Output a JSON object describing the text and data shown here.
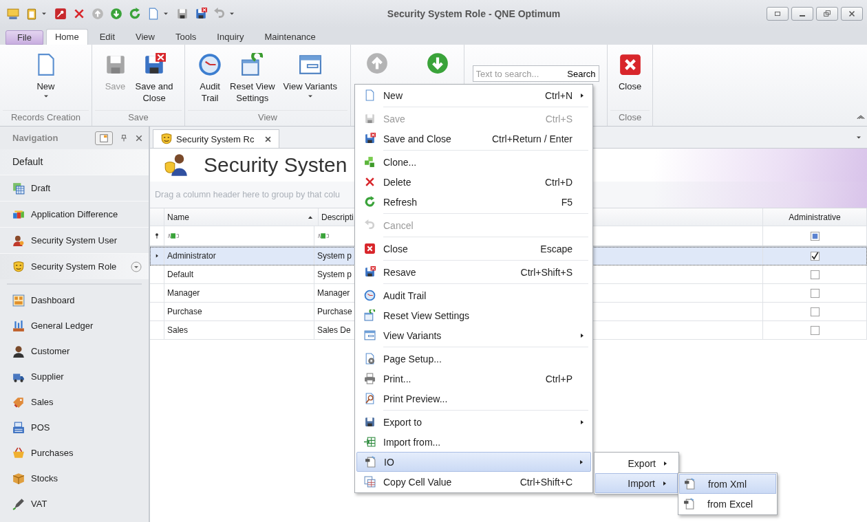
{
  "window": {
    "title": "Security System Role - QNE Optimum"
  },
  "ribbon_tabs": [
    {
      "label": "File",
      "kind": "file",
      "selected": false
    },
    {
      "label": "Home",
      "kind": "tab",
      "selected": true
    },
    {
      "label": "Edit",
      "kind": "tab",
      "selected": false
    },
    {
      "label": "View",
      "kind": "tab",
      "selected": false
    },
    {
      "label": "Tools",
      "kind": "tab",
      "selected": false
    },
    {
      "label": "Inquiry",
      "kind": "tab",
      "selected": false
    },
    {
      "label": "Maintenance",
      "kind": "tab",
      "selected": false
    }
  ],
  "ribbon_groups": [
    {
      "kind": "buttons",
      "label": "Records Creation",
      "buttons": [
        {
          "label": "New",
          "dropdown": true,
          "disabled": false
        }
      ]
    },
    {
      "kind": "buttons",
      "label": "Save",
      "buttons": [
        {
          "label": "Save",
          "dropdown": false,
          "disabled": true
        },
        {
          "label": "Save and\nClose",
          "dropdown": false,
          "disabled": false
        }
      ]
    },
    {
      "kind": "buttons",
      "label": "View",
      "buttons": [
        {
          "label": "Audit\nTrail",
          "dropdown": false,
          "disabled": false
        },
        {
          "label": "Reset View\nSettings",
          "dropdown": false,
          "disabled": false
        },
        {
          "label": "View Variants",
          "dropdown": true,
          "disabled": false
        }
      ]
    },
    {
      "kind": "arrows",
      "buttons": [
        {
          "disabled": true
        },
        {
          "disabled": false
        }
      ]
    },
    {
      "kind": "search",
      "placeholder": "Text to search...",
      "button": "Search"
    },
    {
      "kind": "buttons",
      "label": "Close",
      "buttons": [
        {
          "label": "Close",
          "dropdown": false,
          "disabled": false
        }
      ]
    }
  ],
  "navigation": {
    "title": "Navigation",
    "group_label": "Default",
    "group_items": [
      {
        "label": "Draft",
        "selected": false
      },
      {
        "label": "Application Difference",
        "selected": false
      },
      {
        "label": "Security System User",
        "selected": false
      },
      {
        "label": "Security System Role",
        "selected": true
      }
    ],
    "modules": [
      {
        "label": "Dashboard"
      },
      {
        "label": "General Ledger"
      },
      {
        "label": "Customer"
      },
      {
        "label": "Supplier"
      },
      {
        "label": "Sales"
      },
      {
        "label": "POS"
      },
      {
        "label": "Purchases"
      },
      {
        "label": "Stocks"
      },
      {
        "label": "VAT"
      }
    ]
  },
  "document_tab": {
    "label": "Security System Rc"
  },
  "page_title": "Security Systen",
  "group_hint": "Drag a column header here to group by that colu",
  "grid": {
    "columns": [
      {
        "label": "Name",
        "sorted_ascending": true
      },
      {
        "label": "Descripti"
      },
      {
        "label": "Administrative"
      }
    ],
    "administrative_filter": {
      "indeterminate": true
    },
    "rows": [
      {
        "name": "Administrator",
        "description": "System p",
        "administrative": true,
        "selected": true
      },
      {
        "name": "Default",
        "description": "System p",
        "administrative": false,
        "selected": false
      },
      {
        "name": "Manager",
        "description": "Manager",
        "administrative": false,
        "selected": false
      },
      {
        "name": "Purchase",
        "description": "Purchase",
        "administrative": false,
        "selected": false
      },
      {
        "name": "Sales",
        "description": "Sales De",
        "administrative": false,
        "selected": false
      }
    ]
  },
  "context_menu": {
    "items": [
      {
        "kind": "item",
        "label": "New",
        "shortcut": "Ctrl+N",
        "submenu": true,
        "disabled": false,
        "selected": false
      },
      {
        "kind": "separator"
      },
      {
        "kind": "item",
        "label": "Save",
        "shortcut": "Ctrl+S",
        "submenu": false,
        "disabled": true,
        "selected": false
      },
      {
        "kind": "item",
        "label": "Save and Close",
        "shortcut": "Ctrl+Return / Enter",
        "submenu": false,
        "disabled": false,
        "selected": false
      },
      {
        "kind": "separator"
      },
      {
        "kind": "item",
        "label": "Clone...",
        "submenu": false,
        "disabled": false,
        "selected": false
      },
      {
        "kind": "item",
        "label": "Delete",
        "shortcut": "Ctrl+D",
        "submenu": false,
        "disabled": false,
        "selected": false
      },
      {
        "kind": "item",
        "label": "Refresh",
        "shortcut": "F5",
        "submenu": false,
        "disabled": false,
        "selected": false
      },
      {
        "kind": "separator"
      },
      {
        "kind": "item",
        "label": "Cancel",
        "submenu": false,
        "disabled": true,
        "selected": false
      },
      {
        "kind": "separator"
      },
      {
        "kind": "item",
        "label": "Close",
        "shortcut": "Escape",
        "submenu": false,
        "disabled": false,
        "selected": false
      },
      {
        "kind": "separator"
      },
      {
        "kind": "item",
        "label": "Resave",
        "shortcut": "Ctrl+Shift+S",
        "submenu": false,
        "disabled": false,
        "selected": false
      },
      {
        "kind": "separator"
      },
      {
        "kind": "item",
        "label": "Audit Trail",
        "submenu": false,
        "disabled": false,
        "selected": false
      },
      {
        "kind": "item",
        "label": "Reset View Settings",
        "submenu": false,
        "disabled": false,
        "selected": false
      },
      {
        "kind": "item",
        "label": "View Variants",
        "submenu": true,
        "disabled": false,
        "selected": false
      },
      {
        "kind": "separator"
      },
      {
        "kind": "item",
        "label": "Page Setup...",
        "submenu": false,
        "disabled": false,
        "selected": false
      },
      {
        "kind": "item",
        "label": "Print...",
        "shortcut": "Ctrl+P",
        "submenu": false,
        "disabled": false,
        "selected": false
      },
      {
        "kind": "item",
        "label": "Print Preview...",
        "submenu": false,
        "disabled": false,
        "selected": false
      },
      {
        "kind": "separator"
      },
      {
        "kind": "item",
        "label": "Export to",
        "submenu": true,
        "disabled": false,
        "selected": false
      },
      {
        "kind": "item",
        "label": "Import from...",
        "submenu": false,
        "disabled": false,
        "selected": false
      },
      {
        "kind": "item",
        "label": "IO",
        "submenu": true,
        "disabled": false,
        "selected": true
      },
      {
        "kind": "item",
        "label": "Copy Cell Value",
        "shortcut": "Ctrl+Shift+C",
        "submenu": false,
        "disabled": false,
        "selected": false
      }
    ]
  },
  "io_submenu": [
    {
      "label": "Export",
      "selected": false
    },
    {
      "label": "Import",
      "selected": true
    }
  ],
  "import_submenu": [
    {
      "label": "from Xml",
      "selected": true
    },
    {
      "label": "from Excel",
      "selected": false
    }
  ]
}
